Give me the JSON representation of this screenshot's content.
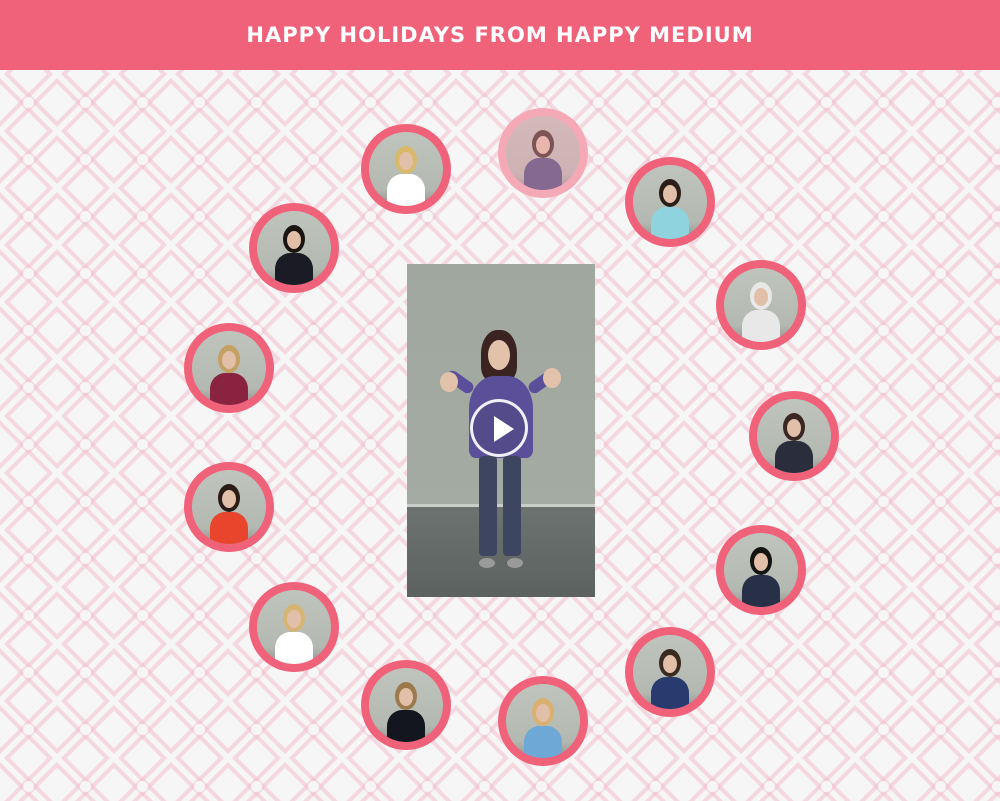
{
  "banner": {
    "title": "HAPPY HOLIDAYS FROM HAPPY MEDIUM"
  },
  "colors": {
    "brand_pink": "#f06279",
    "background": "#f6f6f6",
    "pattern": "#f2becc"
  },
  "main_video": {
    "play_icon": "play-icon",
    "subject": {
      "shirt": "#5b4f9a",
      "pants": "#3d4560",
      "hair": "#3a2320"
    }
  },
  "thumbnails": [
    {
      "name": "thumb-1",
      "shirt": "#ffffff",
      "hair": "#d9b96a",
      "faded": false
    },
    {
      "name": "thumb-2",
      "shirt": "#3e3f7a",
      "hair": "#2e1d18",
      "faded": true
    },
    {
      "name": "thumb-3",
      "shirt": "#8fd3de",
      "hair": "#2b1e18",
      "faded": false
    },
    {
      "name": "thumb-4",
      "shirt": "#e8e8e8",
      "hair": "#e8e8e8",
      "faded": false
    },
    {
      "name": "thumb-5",
      "shirt": "#2a2d3c",
      "hair": "#3a2622",
      "faded": false
    },
    {
      "name": "thumb-6",
      "shirt": "#273047",
      "hair": "#141414",
      "faded": false
    },
    {
      "name": "thumb-7",
      "shirt": "#283a6e",
      "hair": "#3a2a20",
      "faded": false
    },
    {
      "name": "thumb-8",
      "shirt": "#6ea8d6",
      "hair": "#d9b070",
      "faded": false
    },
    {
      "name": "thumb-9",
      "shirt": "#14161f",
      "hair": "#9a7a4c",
      "faded": false
    },
    {
      "name": "thumb-10",
      "shirt": "#ffffff",
      "hair": "#d6b574",
      "faded": false
    },
    {
      "name": "thumb-11",
      "shirt": "#e8452c",
      "hair": "#2a1c16",
      "faded": false
    },
    {
      "name": "thumb-12",
      "shirt": "#8a2340",
      "hair": "#c4a064",
      "faded": false
    },
    {
      "name": "thumb-13",
      "shirt": "#1b1b25",
      "hair": "#1b1512",
      "faded": false
    }
  ]
}
